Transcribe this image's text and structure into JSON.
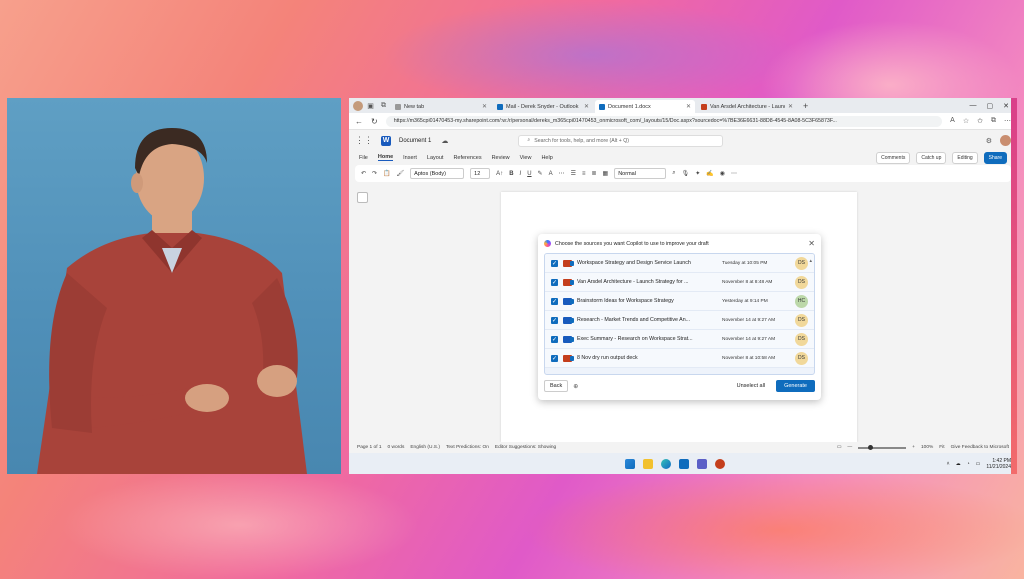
{
  "browser": {
    "tabs": [
      {
        "label": "New tab",
        "active": false
      },
      {
        "label": "Mail - Derek Snyder - Outlook",
        "active": false
      },
      {
        "label": "Document 1.docx",
        "active": true
      },
      {
        "label": "Van Arsdel Architecture - Launch",
        "active": false
      }
    ],
    "new_tab_symbol": "+",
    "url": "https://m365cpi01470453-my.sharepoint.com/:w:/r/personal/dereks_m365cpi01470453_onmicrosoft_com/_layouts/15/Doc.aspx?sourcedoc=%7BE36E6631-88D8-4545-8A08-5C3F65873F..."
  },
  "word": {
    "doc_name": "Document 1",
    "search_placeholder": "Search for tools, help, and more (Alt + Q)",
    "menu": [
      "File",
      "Home",
      "Insert",
      "Layout",
      "References",
      "Review",
      "View",
      "Help"
    ],
    "active_menu": "Home",
    "comments_label": "Comments",
    "catchup_label": "Catch up",
    "editing_label": "Editing",
    "share_label": "Share",
    "font_name": "Aptos (Body)",
    "font_size": "12",
    "style_name": "Normal"
  },
  "dialog": {
    "title": "Choose the sources you want Copilot to use to improve your draft",
    "sources": [
      {
        "name": "Workspace Strategy and Design Service Launch",
        "date": "Tuesday at 10:05 PM",
        "owner": "DS"
      },
      {
        "name": "Van Arsdel Architecture - Launch Strategy for ...",
        "date": "November 8 at 8:48 AM",
        "owner": "DS"
      },
      {
        "name": "Brainstorm Ideas for Workspace Strategy",
        "date": "Yesterday at 9:14 PM",
        "owner": "HC"
      },
      {
        "name": "Research - Market Trends and Competitive An...",
        "date": "November 14 at 9:27 AM",
        "owner": "DS"
      },
      {
        "name": "Exec Summary - Research on Workspace Strat...",
        "date": "November 14 at 9:27 AM",
        "owner": "DS"
      },
      {
        "name": "8 Nov dry run output deck",
        "date": "November 8 at 10:58 AM",
        "owner": "DS"
      }
    ],
    "back_label": "Back",
    "unselect_label": "Unselect all",
    "generate_label": "Generate"
  },
  "status": {
    "page": "Page 1 of 1",
    "words": "0 words",
    "language": "English (U.S.)",
    "predictions": "Text Predictions: On",
    "editor": "Editor Suggestions: Showing",
    "zoom": "100%",
    "fit": "Fit",
    "feedback": "Give Feedback to Microsoft"
  },
  "taskbar": {
    "time": "1:42 PM",
    "date": "11/21/2024"
  },
  "colors": {
    "accent": "#0f6cbd",
    "word_blue": "#185abd",
    "stage_blue": "#5f9fc4",
    "sweater": "#a8433a"
  }
}
